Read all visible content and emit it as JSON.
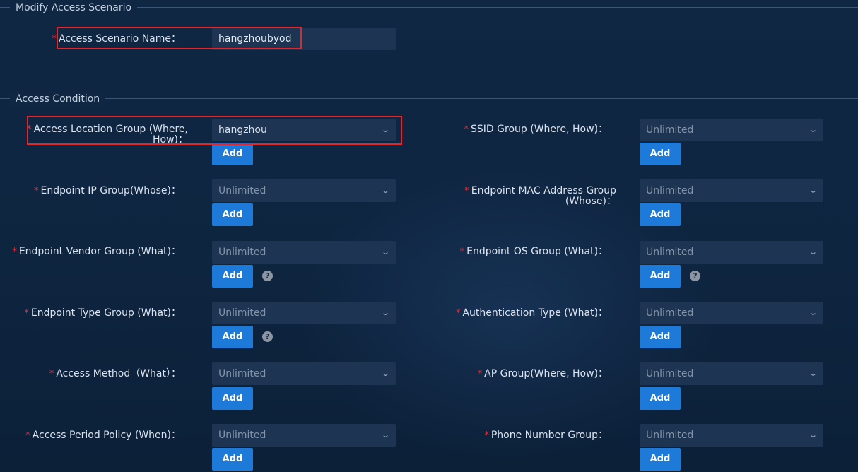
{
  "sections": {
    "modify_title": "Modify Access Scenario",
    "condition_title": "Access Condition"
  },
  "scenario_name": {
    "label": "Access Scenario Name：",
    "value": "hangzhoubyod"
  },
  "add_label": "Add",
  "help_glyph": "?",
  "fields": {
    "location_group": {
      "label": "Access Location Group (Where, How)：",
      "value": "hangzhou"
    },
    "ssid_group": {
      "label": "SSID Group (Where, How)：",
      "value": "Unlimited"
    },
    "endpoint_ip_group": {
      "label": "Endpoint IP Group(Whose)：",
      "value": "Unlimited"
    },
    "endpoint_mac_group": {
      "label": "Endpoint MAC Address Group (Whose)：",
      "value": "Unlimited"
    },
    "endpoint_vendor_group": {
      "label": "Endpoint Vendor Group (What)：",
      "value": "Unlimited"
    },
    "endpoint_os_group": {
      "label": "Endpoint OS Group (What)：",
      "value": "Unlimited"
    },
    "endpoint_type_group": {
      "label": "Endpoint Type Group (What)：",
      "value": "Unlimited"
    },
    "authentication_type": {
      "label": "Authentication Type (What)：",
      "value": "Unlimited"
    },
    "access_method": {
      "label": "Access Method（What）：",
      "value": "Unlimited"
    },
    "ap_group": {
      "label": "AP Group(Where, How)：",
      "value": "Unlimited"
    },
    "access_period_policy": {
      "label": "Access Period Policy (When)：",
      "value": "Unlimited"
    },
    "phone_number_group": {
      "label": "Phone Number Group：",
      "value": "Unlimited"
    }
  },
  "colors": {
    "background": "#0f2743",
    "field_bg": "#1d3552",
    "button": "#1e7ad9",
    "required_star": "#e0303a",
    "highlight_box": "#e4262c"
  },
  "icons": {
    "dropdown": "chevron-down-icon",
    "help": "question-circle-icon",
    "required": "asterisk-icon"
  }
}
